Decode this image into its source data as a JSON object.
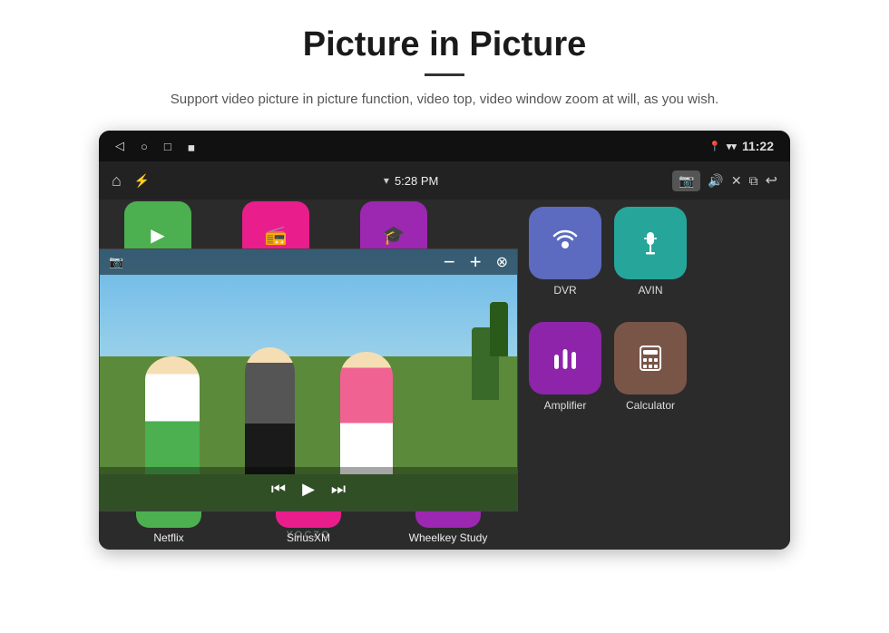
{
  "page": {
    "title": "Picture in Picture",
    "subtitle": "Support video picture in picture function, video top, video window zoom at will, as you wish."
  },
  "statusBar": {
    "time": "11:22",
    "navBack": "◁",
    "navHome": "○",
    "navRecent": "□",
    "navApp": "◼"
  },
  "appBar": {
    "homeIcon": "⌂",
    "usbIcon": "⚡",
    "wifiIcon": "▾",
    "time": "5:28 PM",
    "cameraIcon": "📷",
    "volumeIcon": "🔊",
    "closeIcon": "✕",
    "dupIcon": "⧉",
    "backIcon": "↩"
  },
  "pipWindow": {
    "camIcon": "📷",
    "minusLabel": "−",
    "plusLabel": "+",
    "closeLabel": "⊗"
  },
  "mediaControls": {
    "prev": "⏮",
    "play": "▶",
    "next": "⏭"
  },
  "apps": {
    "rightTop": [
      {
        "id": "dvr",
        "label": "DVR",
        "color": "#5c6bc0",
        "icon": "📡"
      },
      {
        "id": "avin",
        "label": "AVIN",
        "color": "#26a69a",
        "icon": "🔌"
      }
    ],
    "rightBottom": [
      {
        "id": "amplifier",
        "label": "Amplifier",
        "color": "#8e24aa",
        "icon": "🎛"
      },
      {
        "id": "calculator",
        "label": "Calculator",
        "color": "#795548",
        "icon": "🧮"
      }
    ],
    "bottom": [
      {
        "id": "netflix",
        "label": "Netflix",
        "color": "#4caf50",
        "icon": "▶"
      },
      {
        "id": "siriusxm",
        "label": "SiriusXM",
        "color": "#e91e8c",
        "icon": "📻"
      },
      {
        "id": "wheelkey",
        "label": "Wheelkey Study",
        "color": "#9c27b0",
        "icon": "🎓"
      }
    ]
  },
  "watermark": "YOCZO"
}
